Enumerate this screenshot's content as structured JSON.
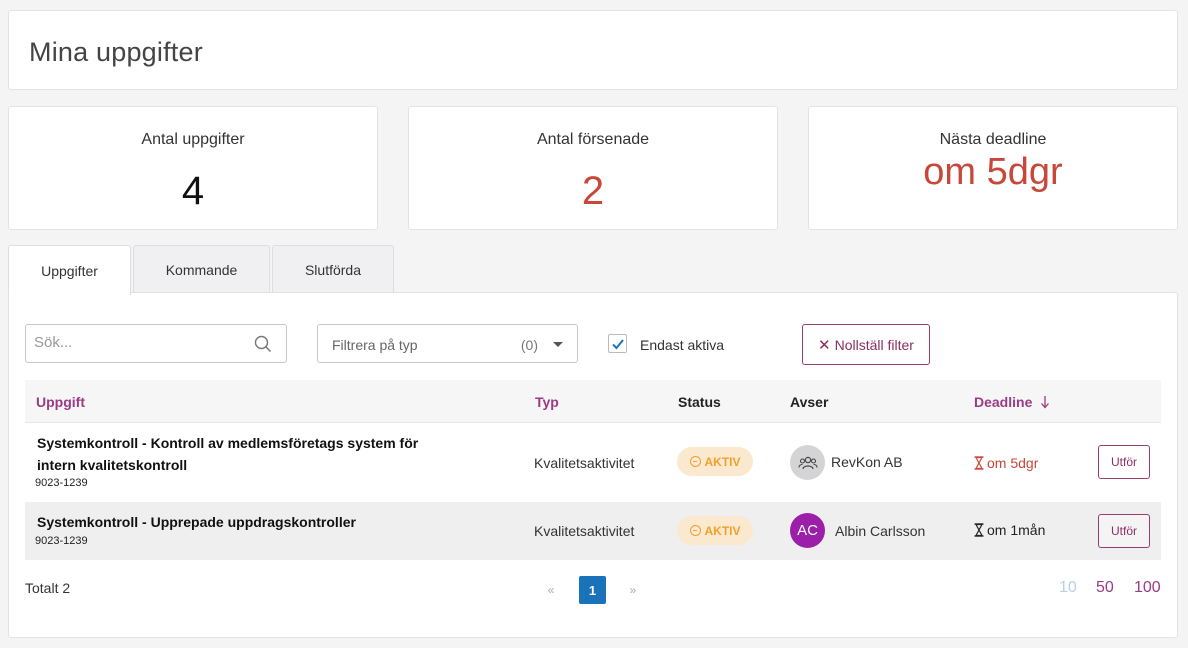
{
  "page": {
    "title": "Mina uppgifter"
  },
  "stats": [
    {
      "label": "Antal uppgifter",
      "value": "4"
    },
    {
      "label": "Antal försenade",
      "value": "2"
    },
    {
      "label": "Nästa deadline",
      "value": "om 5dgr"
    }
  ],
  "colors": {
    "accent": "#9b3b86",
    "danger": "#c9473a",
    "primary": "#1a73b8",
    "badge_bg": "#fbe9cf",
    "badge_fg": "#f0a02d"
  },
  "tabs": [
    {
      "label": "Uppgifter",
      "active": true
    },
    {
      "label": "Kommande",
      "active": false
    },
    {
      "label": "Slutförda",
      "active": false
    }
  ],
  "filters": {
    "search_placeholder": "Sök...",
    "type_placeholder": "Filtrera på typ",
    "type_count": "(0)",
    "only_active_label": "Endast aktiva",
    "only_active_checked": true,
    "reset_label": "Nollställ filter"
  },
  "table": {
    "columns": {
      "task": "Uppgift",
      "type": "Typ",
      "status": "Status",
      "regarding": "Avser",
      "deadline": "Deadline"
    },
    "sort": {
      "column": "deadline",
      "direction": "descending-arrow"
    },
    "rows": [
      {
        "title_line1": "Systemkontroll - Kontroll av medlemsföretags system för",
        "title_line2": "intern kvalitetskontroll",
        "code": "9023-1239",
        "type": "Kvalitetsaktivitet",
        "status": "AKTIV",
        "regarding": "RevKon AB",
        "avatar_icon": "group-icon",
        "deadline": "om 5dgr",
        "deadline_overdue": true,
        "action": "Utför"
      },
      {
        "title_line1": "Systemkontroll - Upprepade uppdragskontroller",
        "code": "9023-1239",
        "type": "Kvalitetsaktivitet",
        "status": "AKTIV",
        "regarding": "Albin Carlsson",
        "avatar_initials": "AC",
        "deadline": "om 1mån",
        "deadline_overdue": false,
        "action": "Utför"
      }
    ]
  },
  "footer": {
    "total": "Totalt 2",
    "prev": "«",
    "current_page": "1",
    "next": "»",
    "page_sizes": [
      "10",
      "50",
      "100"
    ],
    "selected_page_size": "10"
  }
}
